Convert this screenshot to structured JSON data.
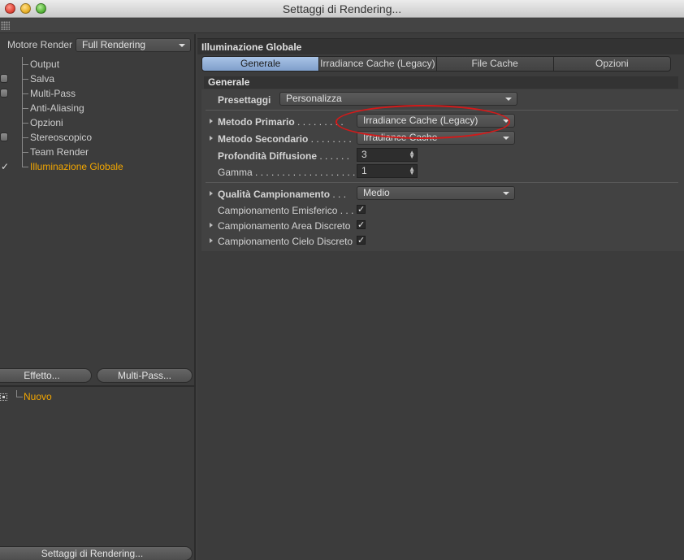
{
  "window": {
    "title": "Settaggi di Rendering..."
  },
  "left": {
    "engine_label": "Motore Render",
    "engine_value": "Full Rendering",
    "tree": [
      {
        "label": "Output",
        "checkbox": false,
        "checked": false,
        "active": false
      },
      {
        "label": "Salva",
        "checkbox": true,
        "checked": false,
        "active": false
      },
      {
        "label": "Multi-Pass",
        "checkbox": true,
        "checked": false,
        "active": false
      },
      {
        "label": "Anti-Aliasing",
        "checkbox": false,
        "checked": false,
        "active": false
      },
      {
        "label": "Opzioni",
        "checkbox": false,
        "checked": false,
        "active": false
      },
      {
        "label": "Stereoscopico",
        "checkbox": true,
        "checked": false,
        "active": false
      },
      {
        "label": "Team Render",
        "checkbox": false,
        "checked": false,
        "active": false
      },
      {
        "label": "Illuminazione Globale",
        "checkbox": false,
        "checked": true,
        "active": true
      }
    ],
    "effect_button": "Effetto...",
    "multipass_button": "Multi-Pass...",
    "preset_item": "Nuovo",
    "render_settings_button": "Settaggi di Rendering..."
  },
  "right": {
    "section_title": "Illuminazione Globale",
    "tabs": [
      {
        "label": "Generale",
        "active": true
      },
      {
        "label": "Irradiance Cache (Legacy)",
        "active": false
      },
      {
        "label": "File Cache",
        "active": false
      },
      {
        "label": "Opzioni",
        "active": false
      }
    ],
    "subsection_title": "Generale",
    "preset": {
      "label": "Presettaggi",
      "value": "Personalizza"
    },
    "primary_method": {
      "label": "Metodo Primario",
      "dots": " . . . . . . . . .",
      "value": "Irradiance Cache (Legacy)"
    },
    "secondary_method": {
      "label": "Metodo Secondario",
      "dots": " . . . . . . . .",
      "value": "Irradiance Cache"
    },
    "diffuse_depth": {
      "label": "Profondità Diffusione",
      "dots": " . . . . . .",
      "value": "3"
    },
    "gamma": {
      "label": "Gamma",
      "dots": " . . . . . . . . . . . . . . . . . . . .",
      "value": "1"
    },
    "sampling_quality": {
      "label": "Qualità Campionamento",
      "dots": " . . .",
      "value": "Medio"
    },
    "hemispheric": {
      "label": "Campionamento Emisferico",
      "dots": " . . .",
      "checked": true
    },
    "discrete_area": {
      "label": "Campionamento Area Discreto",
      "checked": true
    },
    "discrete_sky": {
      "label": "Campionamento Cielo Discreto",
      "checked": true
    },
    "check_glyph": "✓"
  },
  "colors": {
    "accent_orange": "#f2a600",
    "active_tab_blue": "#8fabd6",
    "highlight_ellipse": "#d21a1a"
  }
}
